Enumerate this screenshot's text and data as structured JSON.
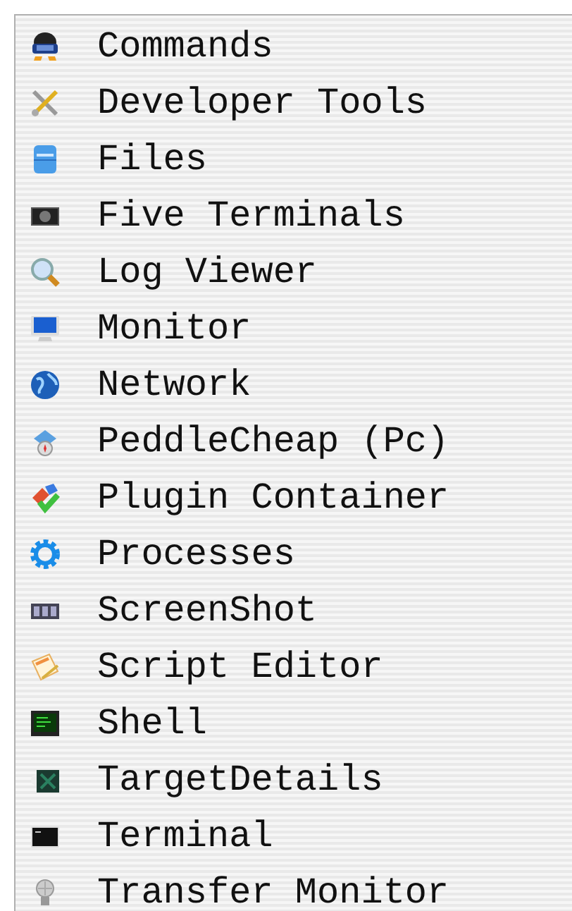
{
  "items": [
    {
      "label": "Commands"
    },
    {
      "label": "Developer Tools"
    },
    {
      "label": "Files"
    },
    {
      "label": "Five Terminals"
    },
    {
      "label": "Log Viewer"
    },
    {
      "label": "Monitor"
    },
    {
      "label": "Network"
    },
    {
      "label": "PeddleCheap (Pc)"
    },
    {
      "label": "Plugin Container"
    },
    {
      "label": "Processes"
    },
    {
      "label": "ScreenShot"
    },
    {
      "label": "Script Editor"
    },
    {
      "label": "Shell"
    },
    {
      "label": "TargetDetails"
    },
    {
      "label": "Terminal"
    },
    {
      "label": "Transfer Monitor"
    }
  ]
}
